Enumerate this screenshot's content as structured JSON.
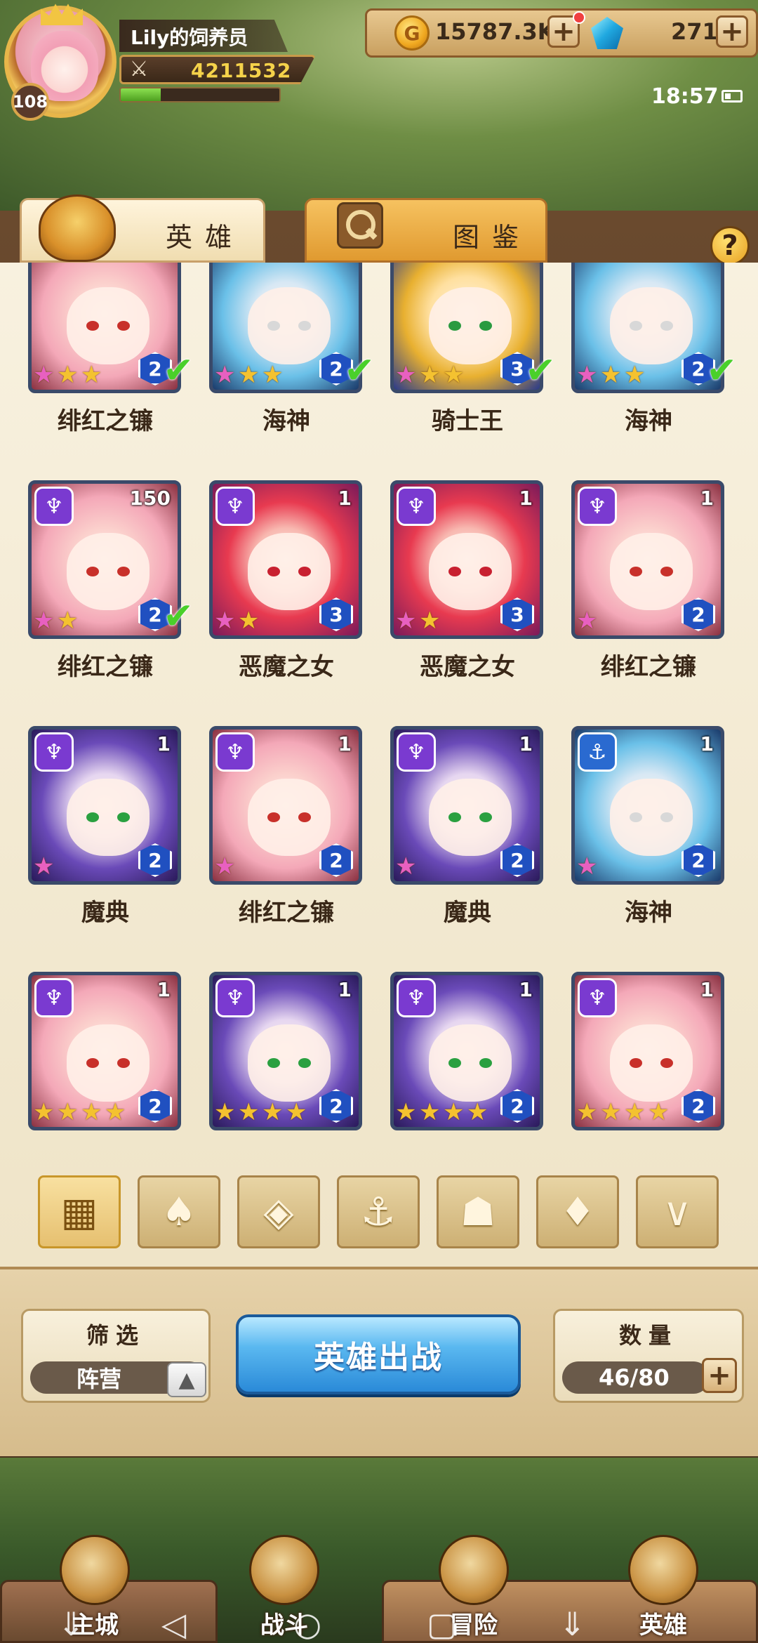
{
  "player": {
    "name": "Lily的饲养员",
    "level": "108",
    "power": "4211532",
    "exp_fraction": 0.25
  },
  "currency": {
    "gold_value": "15787.3K",
    "gem_value": "271",
    "plus_symbol": "+"
  },
  "status": {
    "time": "18:57"
  },
  "tabs": {
    "heroes": "英雄",
    "atlas": "图鉴"
  },
  "help": "?",
  "heroes": [
    {
      "name": "绯红之镰",
      "level": "",
      "stars": 3,
      "star_type": "rainbow",
      "grade": "2",
      "deployed": true,
      "faction": "",
      "style": "pink"
    },
    {
      "name": "海神",
      "level": "",
      "stars": 3,
      "star_type": "rainbow",
      "grade": "2",
      "deployed": true,
      "faction": "",
      "style": "blue"
    },
    {
      "name": "骑士王",
      "level": "",
      "stars": 3,
      "star_type": "rainbow",
      "grade": "3",
      "deployed": true,
      "faction": "",
      "style": "gold"
    },
    {
      "name": "海神",
      "level": "",
      "stars": 3,
      "star_type": "rainbow",
      "grade": "2",
      "deployed": true,
      "faction": "",
      "style": "blue"
    },
    {
      "name": "绯红之镰",
      "level": "150",
      "stars": 2,
      "star_type": "rainbow",
      "grade": "2",
      "deployed": true,
      "faction": "demon",
      "style": "pink"
    },
    {
      "name": "恶魔之女",
      "level": "1",
      "stars": 2,
      "star_type": "rainbow",
      "grade": "3",
      "deployed": false,
      "faction": "demon",
      "style": "red"
    },
    {
      "name": "恶魔之女",
      "level": "1",
      "stars": 2,
      "star_type": "rainbow",
      "grade": "3",
      "deployed": false,
      "faction": "demon",
      "style": "red"
    },
    {
      "name": "绯红之镰",
      "level": "1",
      "stars": 1,
      "star_type": "rainbow",
      "grade": "2",
      "deployed": false,
      "faction": "demon",
      "style": "pink"
    },
    {
      "name": "魔典",
      "level": "1",
      "stars": 1,
      "star_type": "rainbow",
      "grade": "2",
      "deployed": false,
      "faction": "demon",
      "style": "purple"
    },
    {
      "name": "绯红之镰",
      "level": "1",
      "stars": 1,
      "star_type": "rainbow",
      "grade": "2",
      "deployed": false,
      "faction": "demon",
      "style": "pink"
    },
    {
      "name": "魔典",
      "level": "1",
      "stars": 1,
      "star_type": "rainbow",
      "grade": "2",
      "deployed": false,
      "faction": "demon",
      "style": "purple"
    },
    {
      "name": "海神",
      "level": "1",
      "stars": 1,
      "star_type": "rainbow",
      "grade": "2",
      "deployed": false,
      "faction": "sea",
      "style": "blue"
    },
    {
      "name": "",
      "level": "1",
      "stars": 4,
      "star_type": "gold",
      "grade": "2",
      "deployed": false,
      "faction": "demon",
      "style": "pink"
    },
    {
      "name": "",
      "level": "1",
      "stars": 4,
      "star_type": "gold",
      "grade": "2",
      "deployed": false,
      "faction": "demon",
      "style": "purple"
    },
    {
      "name": "",
      "level": "1",
      "stars": 4,
      "star_type": "gold",
      "grade": "2",
      "deployed": false,
      "faction": "demon",
      "style": "purple"
    },
    {
      "name": "",
      "level": "1",
      "stars": 4,
      "star_type": "gold",
      "grade": "2",
      "deployed": false,
      "faction": "demon",
      "style": "pink"
    }
  ],
  "filters": [
    {
      "icon": "grid-icon",
      "symbol": "▦",
      "active": true
    },
    {
      "icon": "forest-faction-icon",
      "symbol": "♠",
      "active": false
    },
    {
      "icon": "diamond-faction-icon",
      "symbol": "◈",
      "active": false
    },
    {
      "icon": "anchor-faction-icon",
      "symbol": "⚓",
      "active": false
    },
    {
      "icon": "beast-faction-icon",
      "symbol": "☗",
      "active": false
    },
    {
      "icon": "demon-faction-icon",
      "symbol": "♦",
      "active": false
    },
    {
      "icon": "horns-faction-icon",
      "symbol": "∨",
      "active": false
    }
  ],
  "controls": {
    "filter_title": "筛选",
    "filter_value": "阵营",
    "arrow_symbol": "▲",
    "deploy_label": "英雄出战",
    "count_title": "数量",
    "count_value": "46/80"
  },
  "nav": [
    {
      "label": "主城",
      "icon": "castle-icon"
    },
    {
      "label": "战斗",
      "icon": "crossed-swords-icon"
    },
    {
      "label": "冒险",
      "icon": "adventure-icon"
    },
    {
      "label": "英雄",
      "icon": "hero-icon"
    }
  ],
  "system_nav": {
    "back": "◁",
    "home": "○",
    "recents": "▢",
    "menu": "⇓"
  }
}
